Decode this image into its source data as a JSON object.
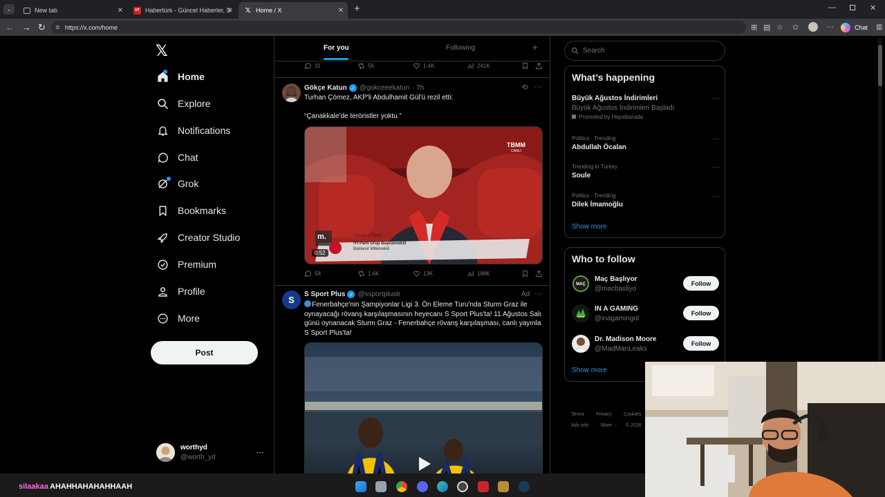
{
  "browser": {
    "tabs": [
      {
        "label": "New tab",
        "icon": "browser-tab-icon"
      },
      {
        "label": "Habertürk - Güncel Haberler, Son",
        "icon": "haberturk-icon"
      },
      {
        "label": "Home / X",
        "icon": "x-logo-icon"
      }
    ],
    "url": "https://x.com/home",
    "chat_label": "Chat"
  },
  "nav": {
    "items": [
      {
        "label": "Home",
        "icon": "home-icon"
      },
      {
        "label": "Explore",
        "icon": "search-icon"
      },
      {
        "label": "Notifications",
        "icon": "bell-icon"
      },
      {
        "label": "Chat",
        "icon": "chat-icon"
      },
      {
        "label": "Grok",
        "icon": "grok-icon"
      },
      {
        "label": "Bookmarks",
        "icon": "bookmark-icon"
      },
      {
        "label": "Creator Studio",
        "icon": "rocket-icon"
      },
      {
        "label": "Premium",
        "icon": "premium-icon"
      },
      {
        "label": "Profile",
        "icon": "person-icon"
      },
      {
        "label": "More",
        "icon": "more-circle-icon"
      }
    ],
    "post_label": "Post",
    "account": {
      "name": "worthyd",
      "handle": "@worth_yd"
    }
  },
  "timeline": {
    "tabs": {
      "for_you": "For you",
      "following": "Following"
    },
    "top_actions": {
      "replies": "31",
      "reposts": "56",
      "likes": "1.4K",
      "views": "241K"
    },
    "tweet1": {
      "name": "Gökçe Katun",
      "handle": "@gokceeekatun",
      "time": "· 7h",
      "text1": "Turhan Çömez, AKP'li Abdulhamit Gül'ü rezil etti:",
      "text2": "“Çanakkale'de teröristler yoktu.”",
      "video": {
        "duration": "0:52",
        "lower_third_name": "Turhan ÇÖMEZ",
        "lower_third_line1": "İYİ Parti Grup Başkanvekili",
        "lower_third_line2": "Balıkesir Milletvekili",
        "channel_logo": "TBMM",
        "channel_sub": "CANLI",
        "watermark": "m."
      },
      "actions": {
        "replies": "58",
        "reposts": "1.6K",
        "likes": "13K",
        "views": "188K"
      }
    },
    "tweet2": {
      "name": "S Sport Plus",
      "handle": "@ssportplustr",
      "ad": "Ad",
      "text": "Fenerbahçe'nin Şampiyonlar Ligi 3. Ön Eleme Turu'nda Sturm Graz ile oynayacağı rövanş karşılaşmasının heyecanı S Sport Plus'ta! 11 Ağustos Salı günü oynanacak Sturm Graz - Fenerbahçe rövanş karşılaşması, canlı yayınla S Sport Plus'ta!"
    }
  },
  "sidebar": {
    "search_placeholder": "Search",
    "happening": {
      "title": "What’s happening",
      "trends": [
        {
          "meta": "",
          "title": "Büyük Ağustos İndirimleri",
          "sub": "Büyük Ağustos İndirimleri Başladı",
          "promo": "Promoted by Hepsiburada"
        },
        {
          "meta": "Politics · Trending",
          "title": "Abdullah Öcalan"
        },
        {
          "meta": "Trending in Turkey",
          "title": "Soule"
        },
        {
          "meta": "Politics · Trending",
          "title": "Dilek İmamoğlu"
        }
      ],
      "show_more": "Show more"
    },
    "who_to_follow": {
      "title": "Who to follow",
      "people": [
        {
          "name": "Maç Başlıyor",
          "handle": "@macbasliyo"
        },
        {
          "name": "IN A GAMING",
          "handle": "@inagamingol"
        },
        {
          "name": "Dr. Madison Moore",
          "handle": "@MadManLeaks"
        }
      ],
      "follow_label": "Follow",
      "show_more": "Show more"
    },
    "footer": {
      "terms": "Terms",
      "privacy": "Privacy",
      "cookies": "Cookies",
      "ads": "Ads info",
      "more": "More ···",
      "copyright": "© 2026"
    }
  },
  "stream_chat": {
    "user": "silaakaa",
    "message": "AHAHHAHAHAHHAAH"
  },
  "colors": {
    "accent": "#1d9bf0",
    "background": "#000000",
    "border": "#2f3336",
    "muted": "#71767b"
  }
}
